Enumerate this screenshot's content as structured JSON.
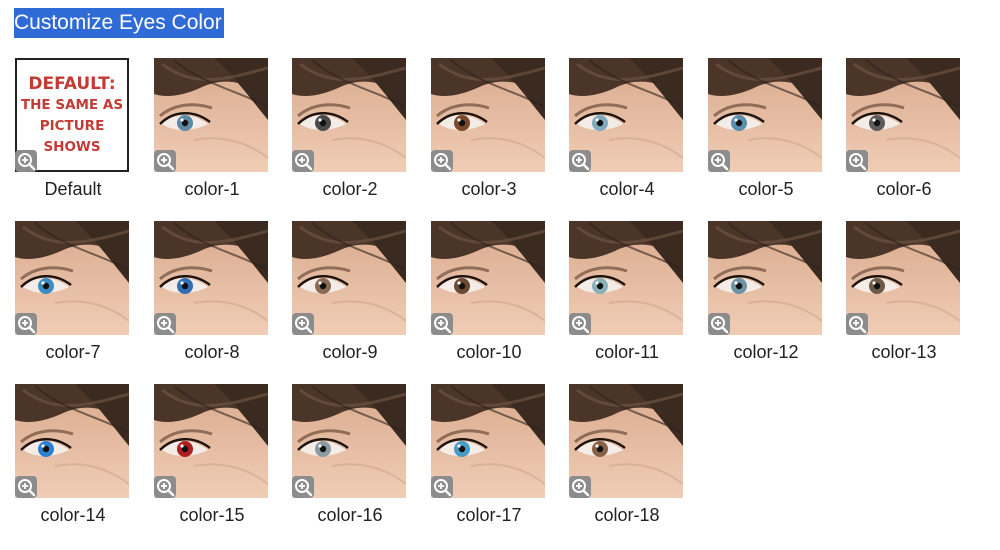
{
  "title": "Customize Eyes Color",
  "default_box": {
    "line1": "DEFAULT:",
    "line2": "THE SAME AS",
    "line3": "PICTURE",
    "line4": "SHOWS"
  },
  "zoom_icon": "zoom-in-icon",
  "options": [
    {
      "label": "Default",
      "iris": null
    },
    {
      "label": "color-1",
      "iris": "#5b89a6"
    },
    {
      "label": "color-2",
      "iris": "#4a4a4a"
    },
    {
      "label": "color-3",
      "iris": "#7a4a2a"
    },
    {
      "label": "color-4",
      "iris": "#7fa9bf"
    },
    {
      "label": "color-5",
      "iris": "#5a8fb0"
    },
    {
      "label": "color-6",
      "iris": "#5e5c5a"
    },
    {
      "label": "color-7",
      "iris": "#3f8cc4"
    },
    {
      "label": "color-8",
      "iris": "#2f6fb5"
    },
    {
      "label": "color-9",
      "iris": "#8a6b52"
    },
    {
      "label": "color-10",
      "iris": "#6b4a36"
    },
    {
      "label": "color-11",
      "iris": "#8ab0b8"
    },
    {
      "label": "color-12",
      "iris": "#6f93a3"
    },
    {
      "label": "color-13",
      "iris": "#6e5a48"
    },
    {
      "label": "color-14",
      "iris": "#2f7fd0"
    },
    {
      "label": "color-15",
      "iris": "#b01f1f"
    },
    {
      "label": "color-16",
      "iris": "#8c9aa4"
    },
    {
      "label": "color-17",
      "iris": "#4a9cc8"
    },
    {
      "label": "color-18",
      "iris": "#8a6048"
    }
  ]
}
